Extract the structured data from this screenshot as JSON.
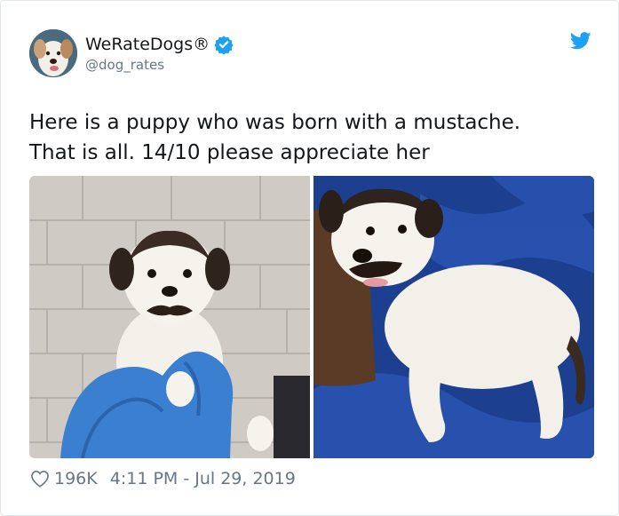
{
  "author": {
    "display_name": "WeRateDogs®",
    "handle": "@dog_rates",
    "avatar_icon": "dog-avatar-icon",
    "verified_icon": "verified-badge-icon"
  },
  "brand": {
    "logo_icon": "twitter-bird-icon",
    "accent": "#1da1f2"
  },
  "tweet": {
    "text": "Here is a puppy who was born with a mustache.\nThat is all. 14/10 please appreciate her"
  },
  "media": [
    {
      "subject": "puppy held in blue-gloved hands against tile wall"
    },
    {
      "subject": "puppy lying on blue blanket"
    }
  ],
  "footer": {
    "like_icon": "heart-icon",
    "likes": "196K",
    "timestamp": "4:11 PM - Jul 29, 2019"
  }
}
